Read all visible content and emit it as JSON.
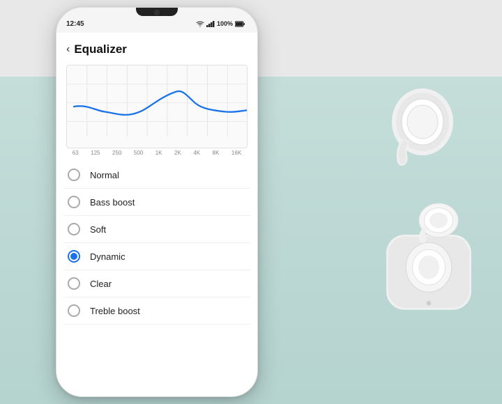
{
  "status_bar": {
    "time": "12:45",
    "battery": "100%",
    "signal": "wifi+cellular"
  },
  "header": {
    "title": "Equalizer",
    "back_label": "‹"
  },
  "eq_chart": {
    "freq_labels": [
      "63",
      "125",
      "250",
      "500",
      "1K",
      "2K",
      "4K",
      "8K",
      "16K"
    ]
  },
  "options": [
    {
      "id": "normal",
      "label": "Normal",
      "selected": false
    },
    {
      "id": "bass_boost",
      "label": "Bass boost",
      "selected": false
    },
    {
      "id": "soft",
      "label": "Soft",
      "selected": false
    },
    {
      "id": "dynamic",
      "label": "Dynamic",
      "selected": true
    },
    {
      "id": "clear",
      "label": "Clear",
      "selected": false
    },
    {
      "id": "treble_boost",
      "label": "Treble boost",
      "selected": false
    }
  ],
  "colors": {
    "accent": "#1a73e8",
    "bg": "#b8d8d4",
    "phone_bg": "#f5f5f5"
  }
}
